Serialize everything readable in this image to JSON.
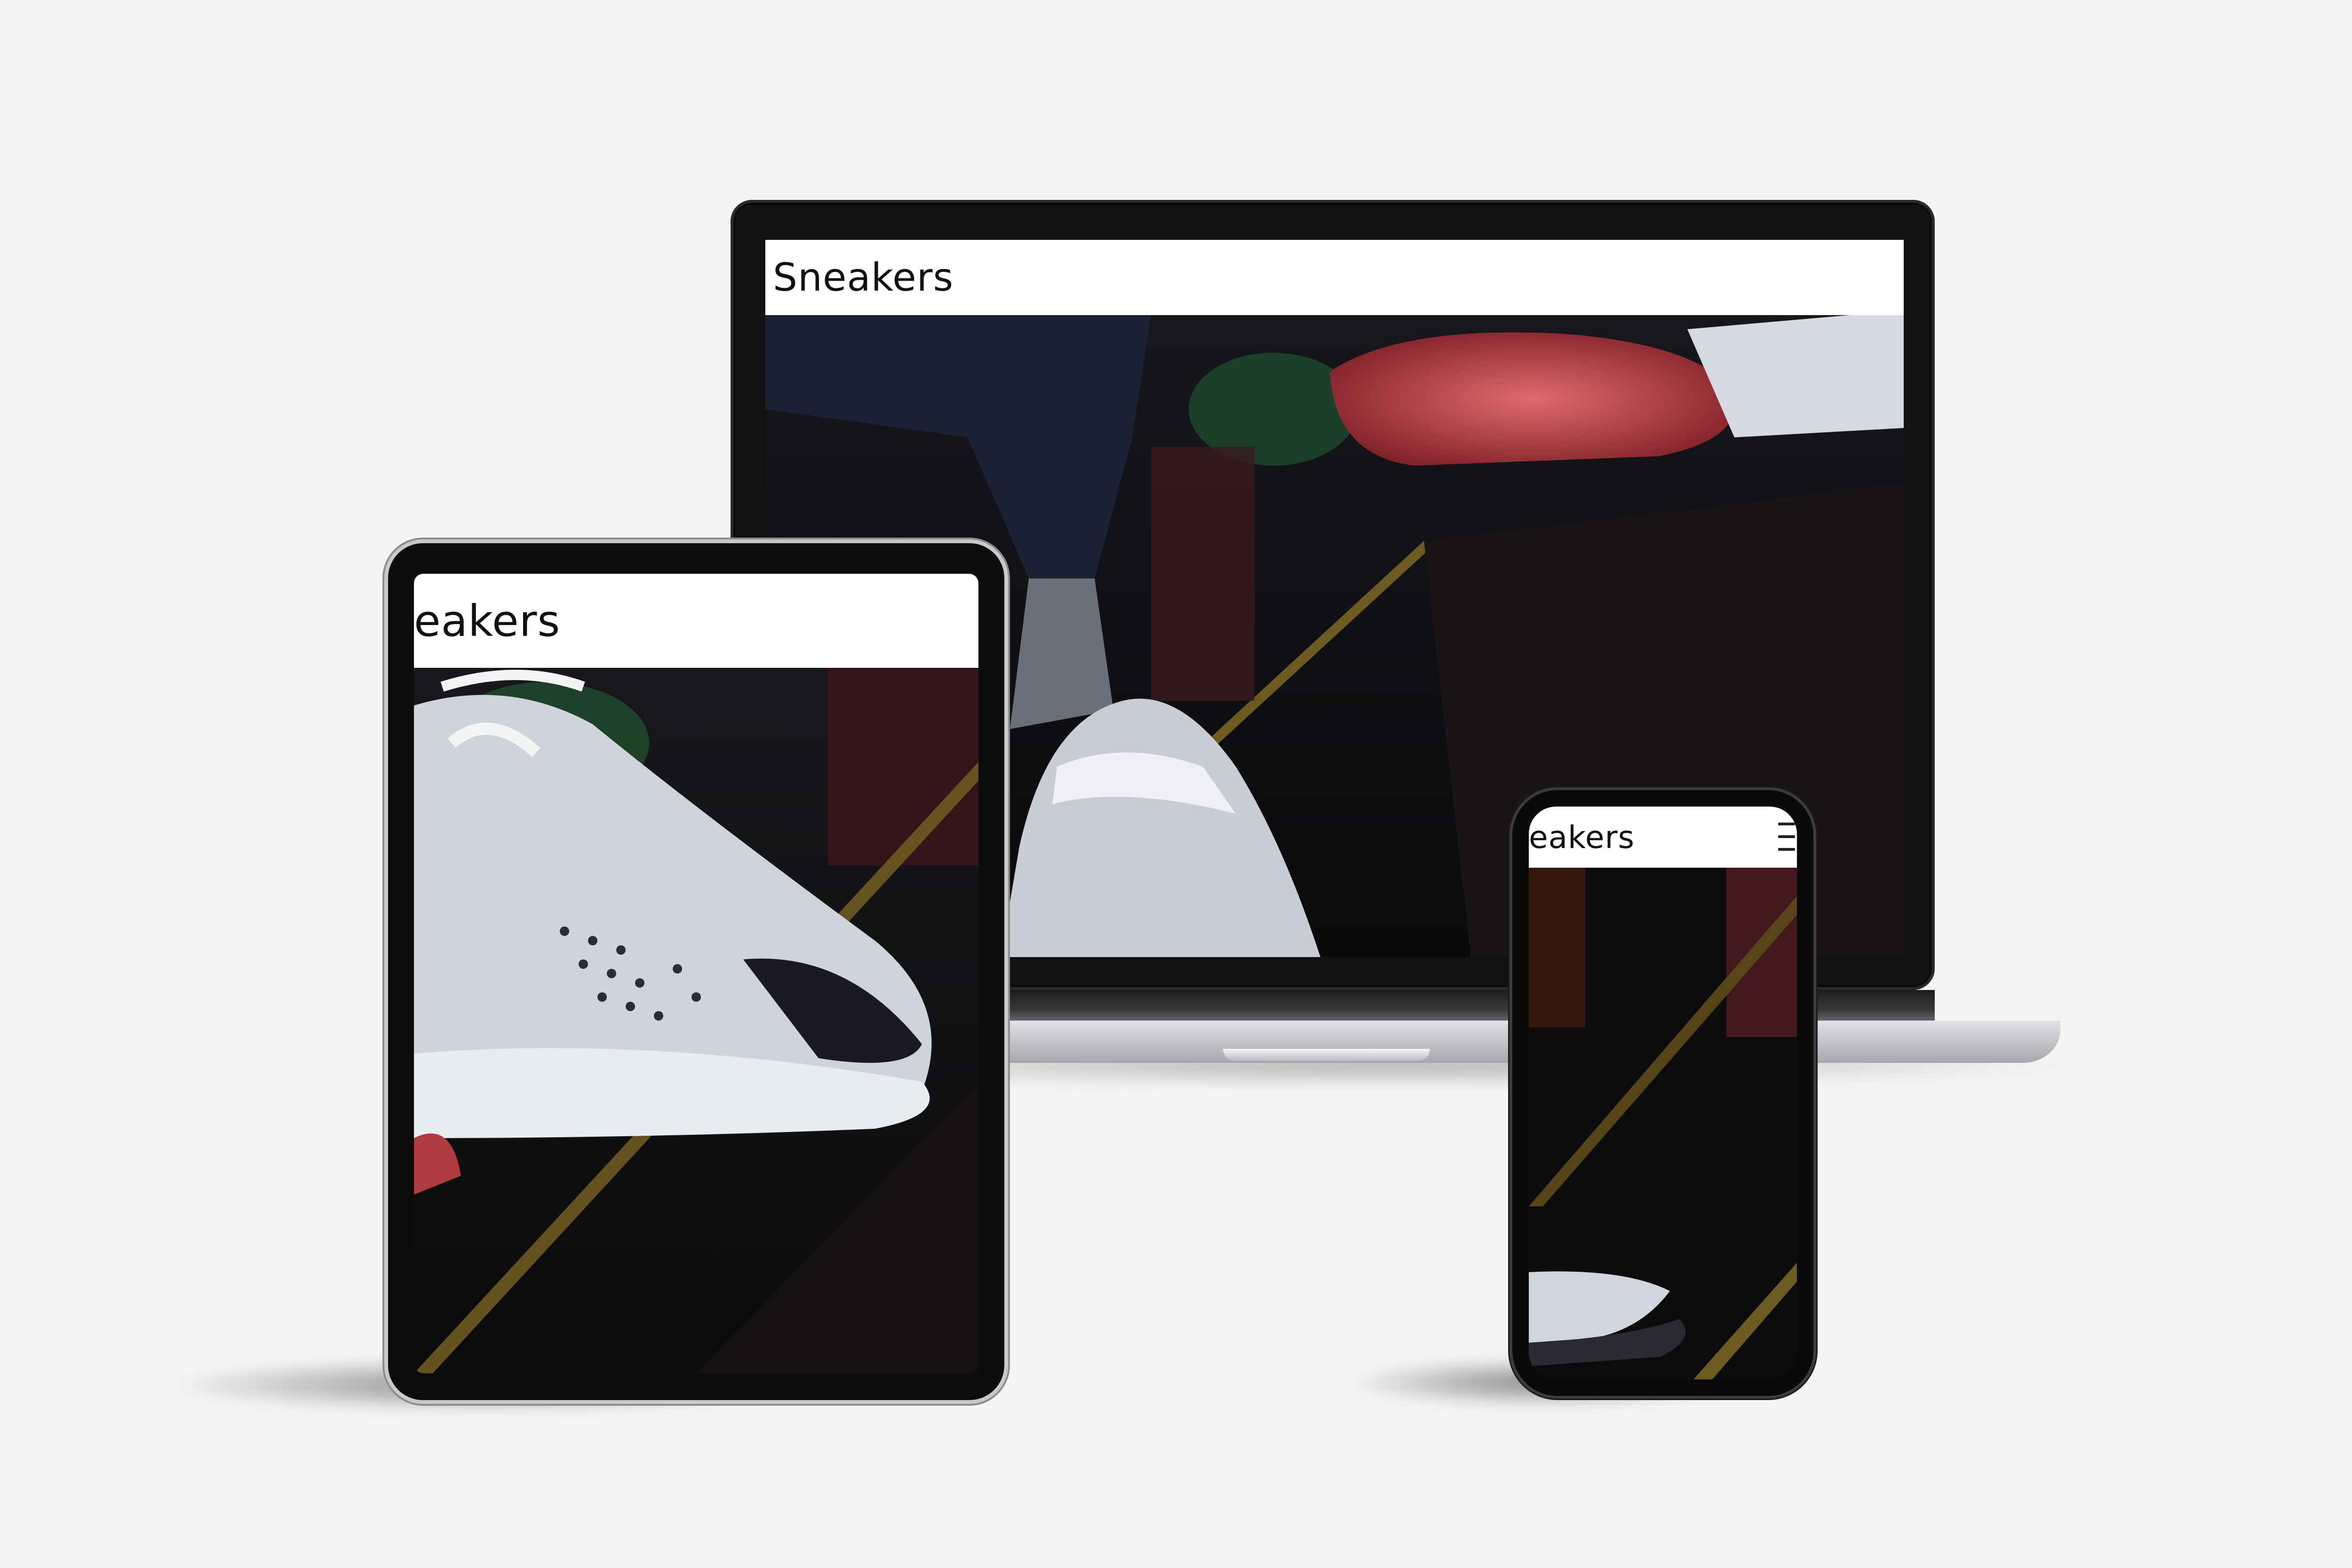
{
  "colors": {
    "background": "#f6f5f3",
    "header_bg": "#ffffff",
    "brand_text": "#111111",
    "hero_dark": "#0b0b0e",
    "shoe_red": "#c2444a",
    "shoe_white": "#d8dce3"
  },
  "laptop": {
    "site_title": "Sneakers"
  },
  "tablet": {
    "site_title": "eakers"
  },
  "phone": {
    "site_title": "eakers",
    "menu_icon": "hamburger-menu-icon"
  }
}
